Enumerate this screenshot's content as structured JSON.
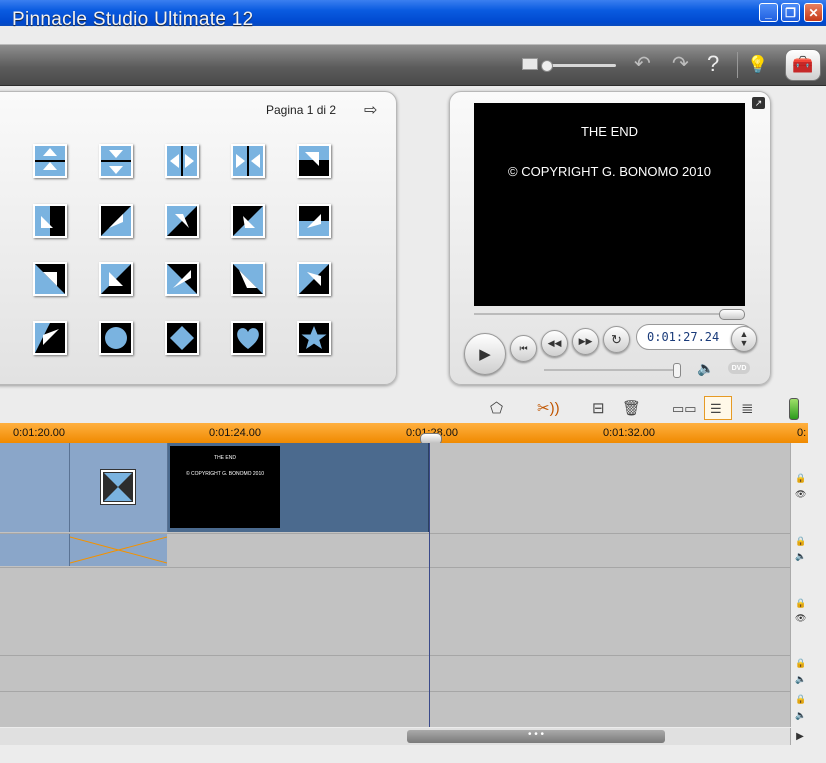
{
  "app": {
    "title": "Pinnacle Studio Ultimate 12"
  },
  "window_controls": {
    "minimize": "_",
    "restore": "❐",
    "close": "✕"
  },
  "header_icons": {
    "undo": "↶",
    "redo": "↷",
    "help": "?",
    "tip": "💡",
    "bag": "🧰"
  },
  "album": {
    "page_label": "Pagina 1 di 2",
    "transitions": [
      "push-up",
      "push-down",
      "squeeze-horizontal",
      "expand-horizontal",
      "slide-down-right",
      "slide-up-left",
      "slide-up-right",
      "slide-down-left",
      "wipe-down-right",
      "wipe-up-right",
      "split-down-right",
      "split-up-left",
      "diagonal-a",
      "diagonal-b",
      "diagonal-c",
      "diagonal-d",
      "circle",
      "diamond",
      "heart",
      "star"
    ]
  },
  "player": {
    "line1": "THE END",
    "line2": "© COPYRIGHT G. BONOMO 2010",
    "timecode": "0:01:27.24",
    "dvd_label": "DVD",
    "scrub_position": 0.95,
    "volume_level": 0.97
  },
  "timeline": {
    "ticks": [
      "0:01:20.00",
      "0:01:24.00",
      "0:01:28.00",
      "0:01:32.00",
      "0:"
    ],
    "clip": {
      "line1": "THE END",
      "line2": "© COPYRIGHT G. BONOMO 2010"
    },
    "scroll_grip": "• • •"
  },
  "colors": {
    "accent_orange": "#f39200",
    "clip_blue": "#8aa6c9",
    "clip_dark": "#4b6a8e"
  }
}
